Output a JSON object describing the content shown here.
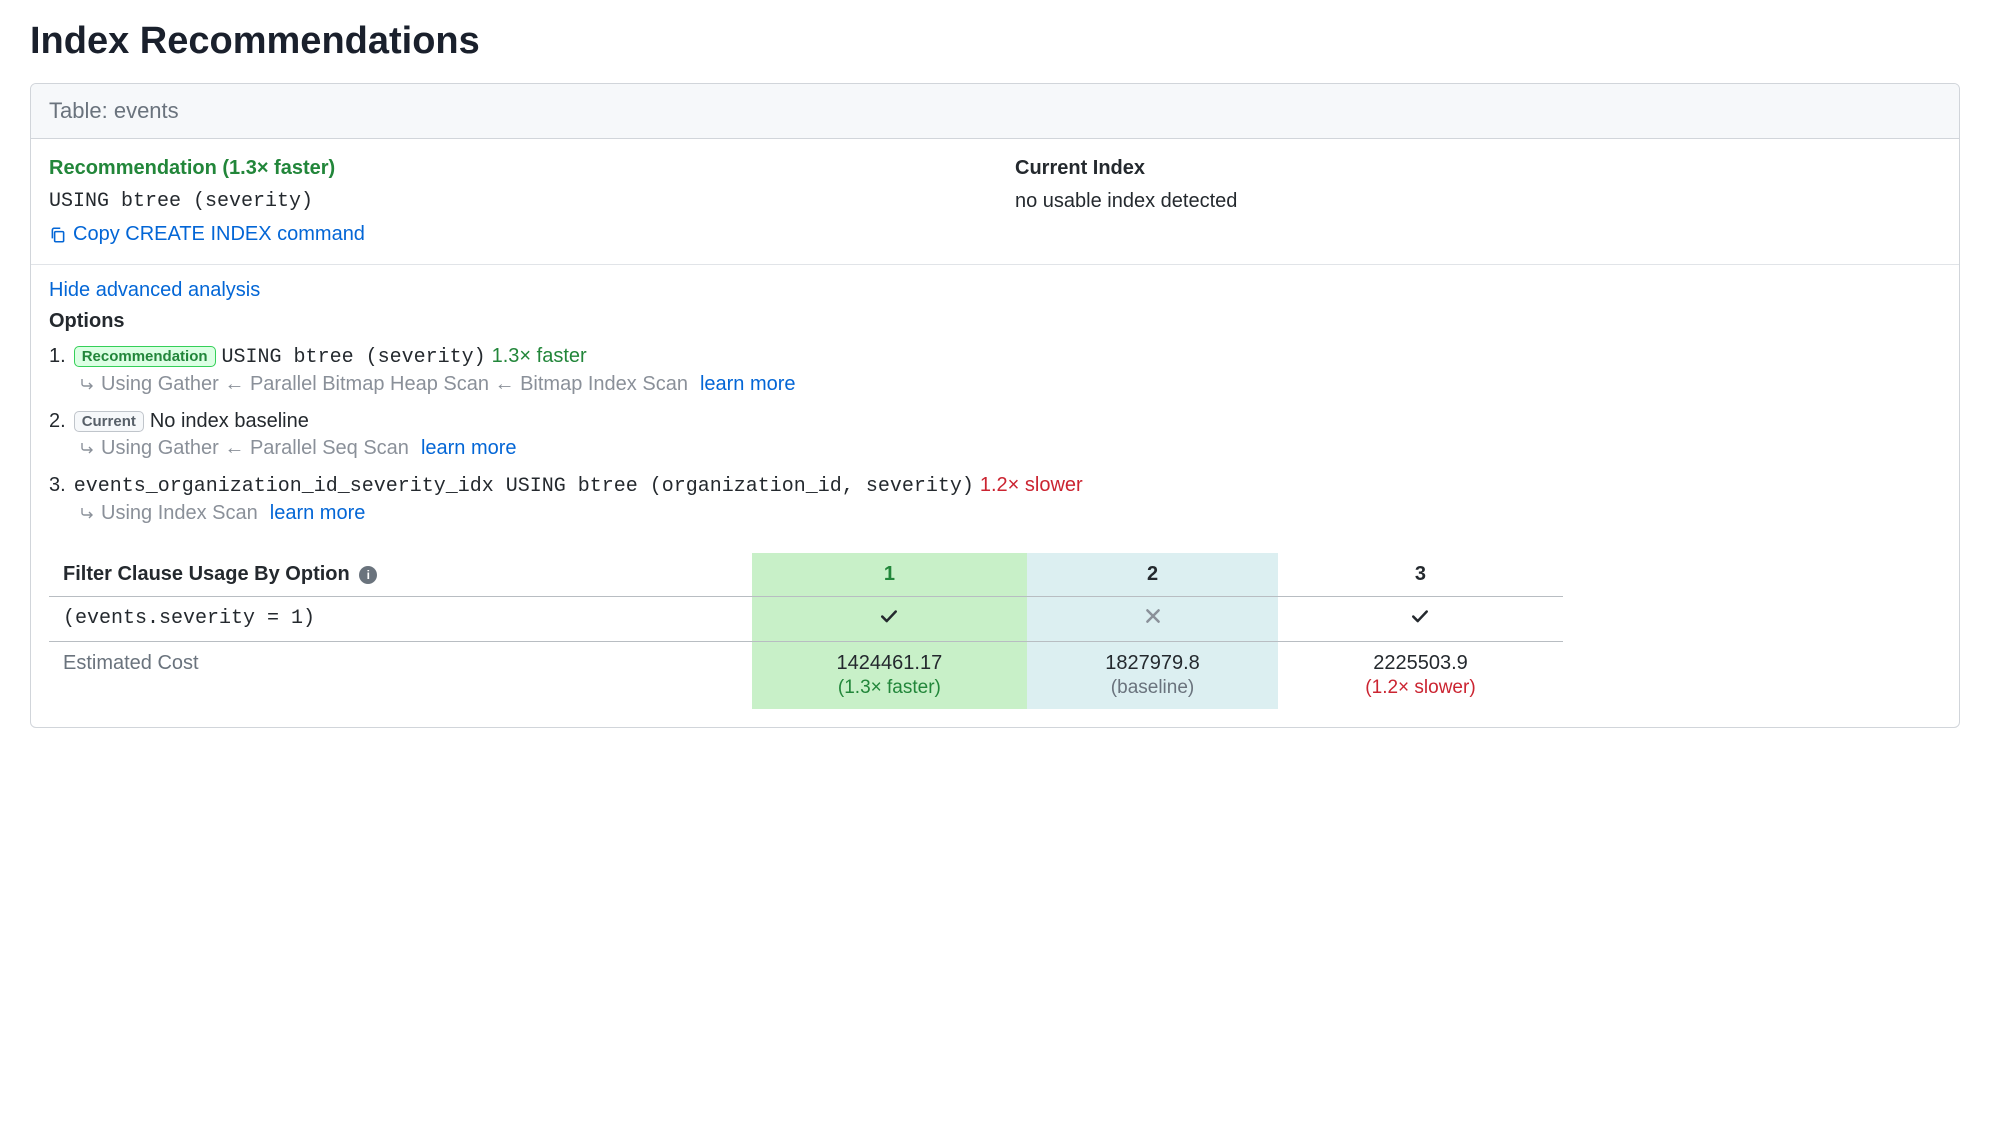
{
  "page_title": "Index Recommendations",
  "table_label_prefix": "Table: ",
  "table_name": "events",
  "recommendation": {
    "label": "Recommendation (1.3× faster)",
    "statement": "USING btree (severity)",
    "copy_link": "Copy CREATE INDEX command"
  },
  "current_index": {
    "label": "Current Index",
    "value": "no usable index detected"
  },
  "hide_link": "Hide advanced analysis",
  "options_label": "Options",
  "options": [
    {
      "num": "1.",
      "badge": "Recommendation",
      "badge_style": "green",
      "statement": "USING btree (severity)",
      "speed": "1.3× faster",
      "speed_style": "green",
      "plan": "Using Gather ← Parallel Bitmap Heap Scan ← Bitmap Index Scan",
      "learn_more": "learn more"
    },
    {
      "num": "2.",
      "badge": "Current",
      "badge_style": "gray",
      "statement": "No index baseline",
      "speed": "",
      "speed_style": "",
      "plan": "Using Gather ← Parallel Seq Scan",
      "learn_more": "learn more"
    },
    {
      "num": "3.",
      "badge": "",
      "badge_style": "",
      "statement": "events_organization_id_severity_idx USING btree (organization_id, severity)",
      "speed": "1.2× slower",
      "speed_style": "red",
      "plan": "Using Index Scan",
      "learn_more": "learn more"
    }
  ],
  "filter_table": {
    "header_label": "Filter Clause Usage By Option",
    "cols": [
      "1",
      "2",
      "3"
    ],
    "filter_clause": "(events.severity = 1)",
    "usage": [
      "check",
      "x",
      "check"
    ],
    "cost_label": "Estimated Cost",
    "costs": [
      {
        "value": "1424461.17",
        "sub": "(1.3× faster)",
        "sub_style": "green"
      },
      {
        "value": "1827979.8",
        "sub": "(baseline)",
        "sub_style": "gray"
      },
      {
        "value": "2225503.9",
        "sub": "(1.2× slower)",
        "sub_style": "red"
      }
    ]
  }
}
